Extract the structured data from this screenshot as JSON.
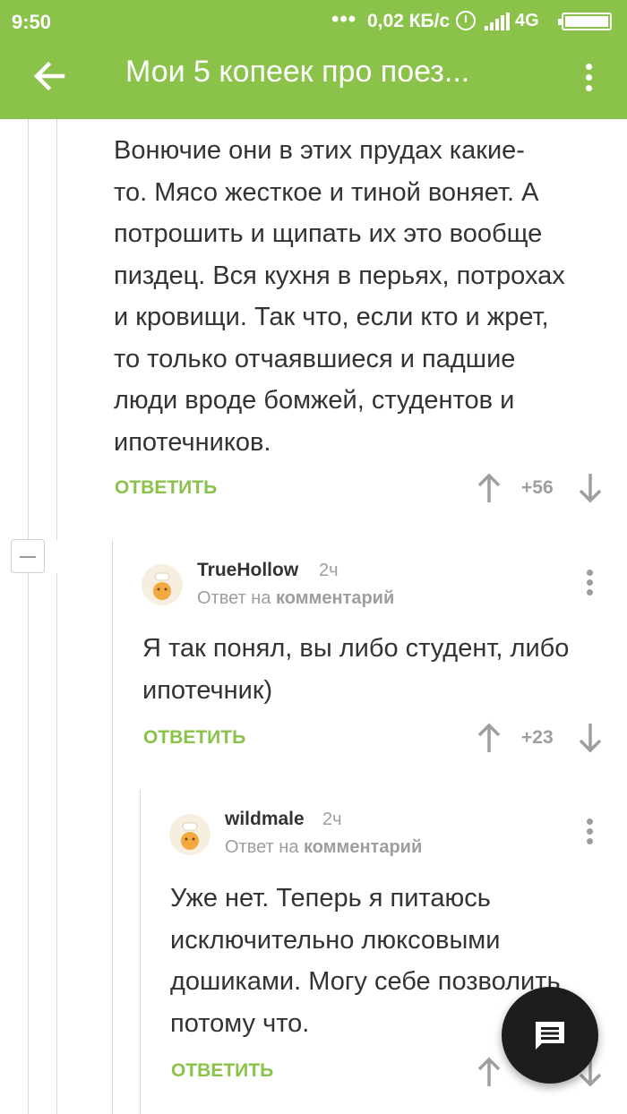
{
  "status_bar": {
    "time": "9:50",
    "dots": "•••",
    "speed": "0,02 КБ/с",
    "network": "4G"
  },
  "app_bar": {
    "title": "Мои 5 копеек про поез..."
  },
  "colors": {
    "brand_green": "#8ac24a",
    "text": "#333333",
    "muted": "#9e9e9e",
    "fab": "#1d1d1d"
  },
  "comments": [
    {
      "lines": [
        "Вонючие они в этих прудах какие-",
        "то. Мясо жесткое и тиной воняет. А",
        "потрошить и щипать их это вообще",
        "пиздец. Вся кухня в перьях, потрохах",
        "и кровищи. Так что, если кто и жрет,",
        "то только отчаявшиеся и падшие",
        "люди вроде бомжей, студентов и",
        "ипотечников."
      ],
      "reply_label": "ОТВЕТИТЬ",
      "score": "+56"
    },
    {
      "author": "TrueHollow",
      "time_ago": "2ч",
      "answer_prefix": "Ответ на",
      "answer_target": "комментарий",
      "lines": [
        "Я так понял, вы либо студент, либо",
        "ипотечник)"
      ],
      "reply_label": "ОТВЕТИТЬ",
      "score": "+23"
    },
    {
      "author": "wildmale",
      "time_ago": "2ч",
      "answer_prefix": "Ответ на",
      "answer_target": "комментарий",
      "lines": [
        "Уже нет. Теперь я питаюсь",
        "исключительно люксовыми",
        "дошиками. Могу себе позволить",
        "потому что."
      ],
      "reply_label": "ОТВЕТИТЬ"
    }
  ],
  "icons": {
    "back": "arrow-left-icon",
    "menu": "more-vertical-icon",
    "upvote": "arrow-up-icon",
    "downvote": "arrow-down-icon",
    "collapse": "minus-icon",
    "fab": "comment-icon"
  }
}
